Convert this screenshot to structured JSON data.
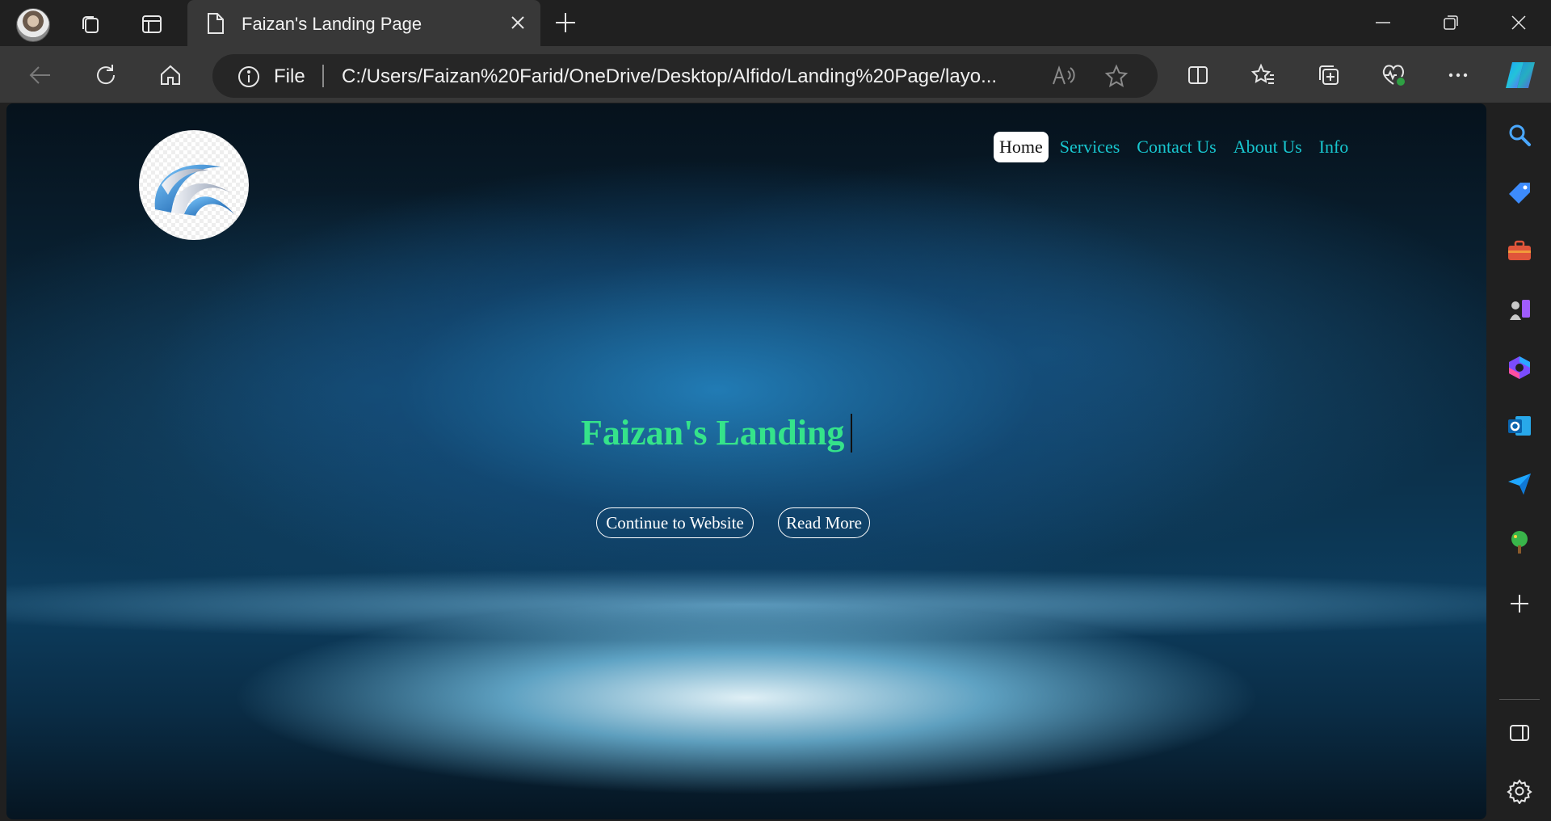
{
  "browser": {
    "tab": {
      "title": "Faizan's Landing Page"
    },
    "address_bar": {
      "scheme_label": "File",
      "url": "C:/Users/Faizan%20Farid/OneDrive/Desktop/Alfido/Landing%20Page/layo..."
    },
    "toolbar_icons": [
      "back-icon",
      "refresh-icon",
      "home-icon",
      "read-aloud-icon",
      "favorite-star-icon",
      "split-screen-icon",
      "favorites-icon",
      "collections-icon",
      "browser-essentials-icon",
      "more-icon",
      "copilot-icon"
    ],
    "sidebar_icons": [
      "search-icon",
      "shopping-icon",
      "tools-icon",
      "games-icon",
      "microsoft-365-icon",
      "outlook-icon",
      "drop-icon",
      "tree-icon",
      "add-icon",
      "sidebar-toggle-icon",
      "settings-icon"
    ]
  },
  "page": {
    "nav": {
      "items": [
        {
          "label": "Home",
          "active": true
        },
        {
          "label": "Services",
          "active": false
        },
        {
          "label": "Contact Us",
          "active": false
        },
        {
          "label": "About Us",
          "active": false
        },
        {
          "label": "Info",
          "active": false
        }
      ]
    },
    "hero": {
      "title": "Faizan's Landing",
      "buttons": {
        "primary": "Continue to Website",
        "secondary": "Read More"
      }
    },
    "colors": {
      "nav_link": "#18c6cf",
      "hero_title": "#35e38a",
      "button_border": "#ffffff"
    }
  }
}
